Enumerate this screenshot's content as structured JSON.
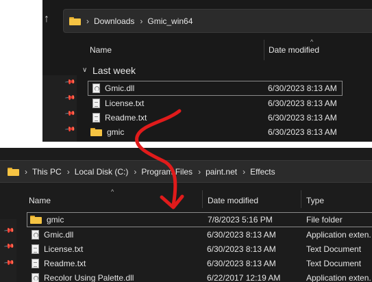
{
  "top": {
    "breadcrumb": [
      "Downloads",
      "Gmic_win64"
    ],
    "columns": {
      "name": "Name",
      "date": "Date modified"
    },
    "group": "Last week",
    "rows": [
      {
        "name": "Gmic.dll",
        "date": "6/30/2023 8:13 AM",
        "icon": "dll-file-icon"
      },
      {
        "name": "License.txt",
        "date": "6/30/2023 8:13 AM",
        "icon": "text-file-icon"
      },
      {
        "name": "Readme.txt",
        "date": "6/30/2023 8:13 AM",
        "icon": "text-file-icon"
      },
      {
        "name": "gmic",
        "date": "6/30/2023 8:13 AM",
        "icon": "folder-icon"
      }
    ]
  },
  "bottom": {
    "breadcrumb": [
      "This PC",
      "Local Disk (C:)",
      "Program Files",
      "paint.net",
      "Effects"
    ],
    "columns": {
      "name": "Name",
      "date": "Date modified",
      "type": "Type"
    },
    "rows": [
      {
        "name": "gmic",
        "date": "7/8/2023 5:16 PM",
        "type": "File folder",
        "icon": "folder-icon"
      },
      {
        "name": "Gmic.dll",
        "date": "6/30/2023 8:13 AM",
        "type": "Application exten.",
        "icon": "dll-file-icon"
      },
      {
        "name": "License.txt",
        "date": "6/30/2023 8:13 AM",
        "type": "Text Document",
        "icon": "text-file-icon"
      },
      {
        "name": "Readme.txt",
        "date": "6/30/2023 8:13 AM",
        "type": "Text Document",
        "icon": "text-file-icon"
      },
      {
        "name": "Recolor Using Palette.dll",
        "date": "6/22/2017 12:19 AM",
        "type": "Application exten.",
        "icon": "dll-file-icon"
      }
    ]
  },
  "colors": {
    "panel_bg": "#191919",
    "folder": "#f6c443",
    "annotation_arrow": "#e01b1b"
  }
}
